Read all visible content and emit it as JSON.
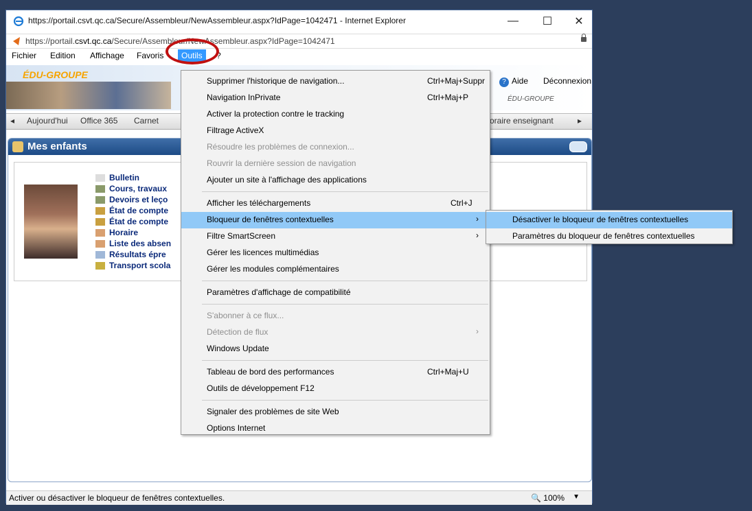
{
  "window": {
    "title": "https://portail.csvt.qc.ca/Secure/Assembleur/NewAssembleur.aspx?IdPage=1042471 - Internet Explorer",
    "minimize": "—",
    "maximize": "☐",
    "close": "✕"
  },
  "address": {
    "prefix": "https://portail.",
    "domain": "csvt.qc.ca",
    "path": "/Secure/Assembleur/NewAssembleur.aspx?IdPage=1042471"
  },
  "menubar": [
    "Fichier",
    "Edition",
    "Affichage",
    "Favoris",
    "Outils",
    "?"
  ],
  "banner": {
    "logo": "ÉDU-GROUPE",
    "help": "Aide",
    "logout": "Déconnexion",
    "logo_small": "ÉDU-GROUPE"
  },
  "tabs": {
    "left_arrow": "◂",
    "items": [
      "Aujourd'hui",
      "Office 365",
      "Carnet"
    ],
    "right_item": "oraire enseignant",
    "right_arrow": "▸"
  },
  "panel": {
    "title": "Mes enfants",
    "links": [
      "Bulletin",
      "Cours, travaux",
      "Devoirs et leço",
      "État de compte",
      "État de compte",
      "Horaire",
      "Liste des absen",
      "Résultats épre",
      "Transport scola"
    ]
  },
  "tools_menu": {
    "items": [
      {
        "label": "Supprimer l'historique de navigation...",
        "shortcut": "Ctrl+Maj+Suppr"
      },
      {
        "label": "Navigation InPrivate",
        "shortcut": "Ctrl+Maj+P"
      },
      {
        "label": "Activer la protection contre le tracking"
      },
      {
        "label": "Filtrage ActiveX"
      },
      {
        "label": "Résoudre les problèmes de connexion...",
        "disabled": true
      },
      {
        "label": "Rouvrir la dernière session de navigation",
        "disabled": true
      },
      {
        "label": "Ajouter un site à l'affichage des applications"
      },
      {
        "label": "Afficher les téléchargements",
        "shortcut": "Ctrl+J"
      },
      {
        "label": "Bloqueur de fenêtres contextuelles",
        "submenu": true
      },
      {
        "label": "Filtre SmartScreen",
        "submenu": true
      },
      {
        "label": "Gérer les licences multimédias"
      },
      {
        "label": "Gérer les modules complémentaires"
      },
      {
        "label": "Paramètres d'affichage de compatibilité"
      },
      {
        "label": "S'abonner à ce flux...",
        "disabled": true
      },
      {
        "label": "Détection de flux",
        "disabled": true,
        "submenu": true
      },
      {
        "label": "Windows Update"
      },
      {
        "label": "Tableau de bord des performances",
        "shortcut": "Ctrl+Maj+U"
      },
      {
        "label": "Outils de développement F12"
      },
      {
        "label": "Signaler des problèmes de site Web"
      },
      {
        "label": "Options Internet"
      }
    ]
  },
  "popup_submenu": {
    "items": [
      "Désactiver le bloqueur de fenêtres contextuelles",
      "Paramètres du bloqueur de fenêtres contextuelles"
    ]
  },
  "status": {
    "text": "Activer ou désactiver le bloqueur de fenêtres contextuelles.",
    "zoom": "🔍 100%",
    "zoom_arrow": "▼"
  }
}
